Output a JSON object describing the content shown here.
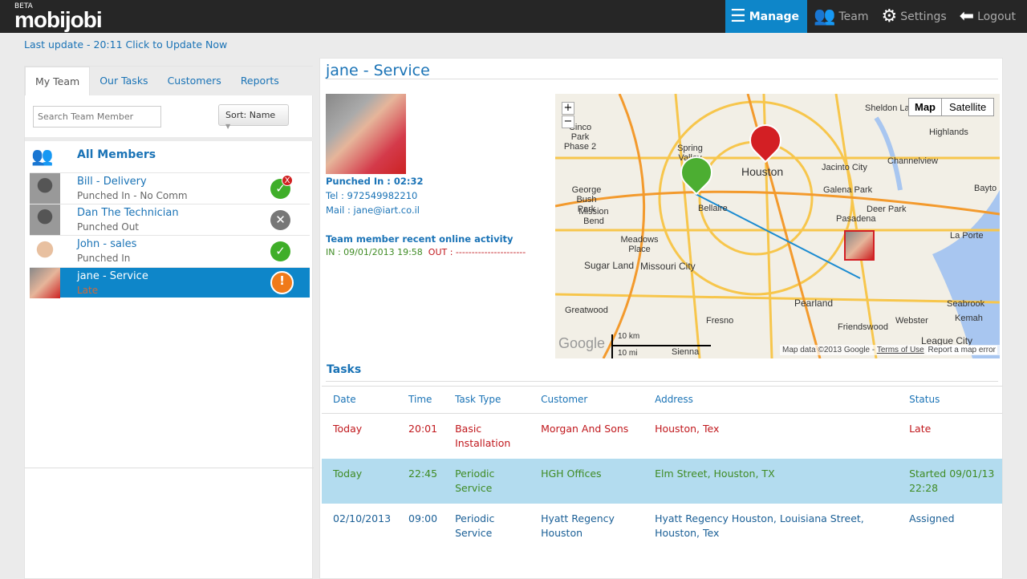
{
  "header": {
    "beta": "BETA",
    "logo": "mobijobi",
    "nav": [
      {
        "label": "Manage",
        "icon": "list-icon",
        "active": true
      },
      {
        "label": "Team",
        "icon": "team-icon"
      },
      {
        "label": "Settings",
        "icon": "gear-icon"
      },
      {
        "label": "Logout",
        "icon": "arrow-left-icon"
      }
    ]
  },
  "update_text": "Last update - 20:11 Click to Update Now",
  "sidebar": {
    "tabs": [
      "My Team",
      "Our Tasks",
      "Customers",
      "Reports"
    ],
    "search_placeholder": "Search Team Member",
    "sort_label": "Sort: Name",
    "all_members": "All Members",
    "members": [
      {
        "name": "Bill - Delivery",
        "status": "Punched In - No Comm",
        "badge": "check-error",
        "color": "#3fae29"
      },
      {
        "name": "Dan The Technician",
        "status": "Punched Out",
        "badge": "x",
        "color": "#777777"
      },
      {
        "name": "John - sales",
        "status": "Punched In",
        "badge": "check",
        "color": "#3fae29"
      },
      {
        "name": "jane - Service",
        "status": "Late",
        "badge": "alert",
        "color": "#f07a1a",
        "selected": true
      }
    ]
  },
  "detail": {
    "title": "jane - Service",
    "punched_in": "Punched In : 02:32",
    "tel": "Tel : 972549982210",
    "mail": "Mail : jane@iart.co.il",
    "activity_title": "Team member recent online activity",
    "in": "IN : 09/01/2013 19:58",
    "out_label": "OUT :",
    "out_value": "----------------------"
  },
  "map": {
    "types": [
      "Map",
      "Satellite"
    ],
    "labels": [
      "Sheldon Lake State Park",
      "Highlands",
      "Channelview",
      "Bayto",
      "Jacinto City",
      "Galena Park",
      "Deer Park",
      "Pasadena",
      "La Porte",
      "Spring Valley",
      "Houston",
      "Bellaire",
      "Mission Bend",
      "George Bush Park",
      "Meadows Place",
      "Sugar Land",
      "Missouri City",
      "Pearland",
      "Seabrook",
      "Kemah",
      "Greatwood",
      "Fresno",
      "Friendswood",
      "Webster",
      "League City",
      "Cinco Park Phase 2",
      "Sienna"
    ],
    "scale_km": "10 km",
    "scale_mi": "10 mi",
    "attribution": "Map data ©2013 Google -",
    "terms": "Terms of Use",
    "report": "Report a map error",
    "google": "Google"
  },
  "tasks": {
    "title": "Tasks",
    "columns": [
      "Date",
      "Time",
      "Task Type",
      "Customer",
      "Address",
      "Status"
    ],
    "rows": [
      {
        "date": "Today",
        "time": "20:01",
        "type": "Basic Installation",
        "customer": "Morgan And Sons",
        "address": "Houston, Tex",
        "status": "Late"
      },
      {
        "date": "Today",
        "time": "22:45",
        "type": "Periodic Service",
        "customer": "HGH Offices",
        "address": "Elm Street, Houston, TX",
        "status": "Started 09/01/13 22:28"
      },
      {
        "date": "02/10/2013",
        "time": "09:00",
        "type": "Periodic Service",
        "customer": "Hyatt Regency Houston",
        "address": "Hyatt Regency Houston, Louisiana Street, Houston, Tex",
        "status": "Assigned"
      }
    ]
  }
}
